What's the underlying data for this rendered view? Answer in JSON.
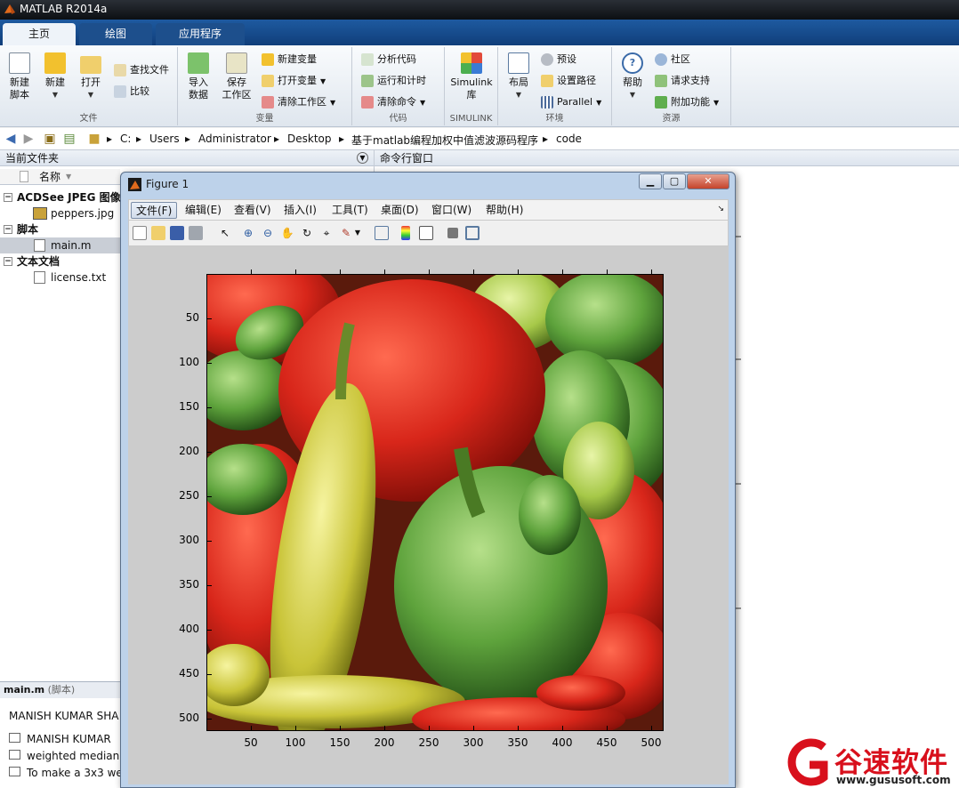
{
  "app": {
    "title": "MATLAB R2014a"
  },
  "ribbon_tabs": [
    {
      "label": "主页"
    },
    {
      "label": "绘图"
    },
    {
      "label": "应用程序"
    }
  ],
  "ribbon": {
    "file": {
      "label": "文件",
      "new_script": "新建\n脚本",
      "new": "新建",
      "open": "打开",
      "find_files": "查找文件",
      "compare": "比较"
    },
    "variable": {
      "label": "变量",
      "import": "导入\n数据",
      "save_ws": "保存\n工作区",
      "new_var": "新建变量",
      "open_var": "打开变量",
      "clear_ws": "清除工作区"
    },
    "code": {
      "label": "代码",
      "analyze": "分析代码",
      "run_time": "运行和计时",
      "clear_cmd": "清除命令"
    },
    "simulink": {
      "label": "SIMULINK",
      "lib": "Simulink\n库"
    },
    "env": {
      "label": "环境",
      "layout": "布局",
      "prefs": "预设",
      "set_path": "设置路径",
      "parallel": "Parallel"
    },
    "resources": {
      "label": "资源",
      "help": "帮助",
      "community": "社区",
      "request_support": "请求支持",
      "addons": "附加功能"
    }
  },
  "address": {
    "parts": [
      "C:",
      "Users",
      "Administrator",
      "Desktop",
      "基于matlab编程加权中值滤波源码程序",
      "code"
    ]
  },
  "current_folder": {
    "title": "当前文件夹",
    "col_name": "名称",
    "groups": [
      {
        "label": "ACDSee JPEG 图像",
        "files": [
          "peppers.jpg"
        ]
      },
      {
        "label": "脚本",
        "files": [
          "main.m"
        ]
      },
      {
        "label": "文本文档",
        "files": [
          "license.txt"
        ]
      }
    ]
  },
  "details": {
    "file": "main.m",
    "type": "(脚本)",
    "heading": "MANISH KUMAR SHA",
    "lines": [
      "MANISH KUMAR",
      "weighted median",
      "To make a 3x3 we"
    ]
  },
  "command_window": {
    "title": "命令行窗口"
  },
  "figure": {
    "title": "Figure 1",
    "menu": [
      "文件(F)",
      "编辑(E)",
      "查看(V)",
      "插入(I)",
      "工具(T)",
      "桌面(D)",
      "窗口(W)",
      "帮助(H)"
    ],
    "yticks": [
      "50",
      "100",
      "150",
      "200",
      "250",
      "300",
      "350",
      "400",
      "450",
      "500"
    ],
    "xticks": [
      "50",
      "100",
      "150",
      "200",
      "250",
      "300",
      "350",
      "400",
      "450",
      "500"
    ],
    "image_name": "peppers"
  },
  "watermark": {
    "brand": "谷速软件",
    "url": "www.gususoft.com",
    "color": "#d8101c"
  }
}
